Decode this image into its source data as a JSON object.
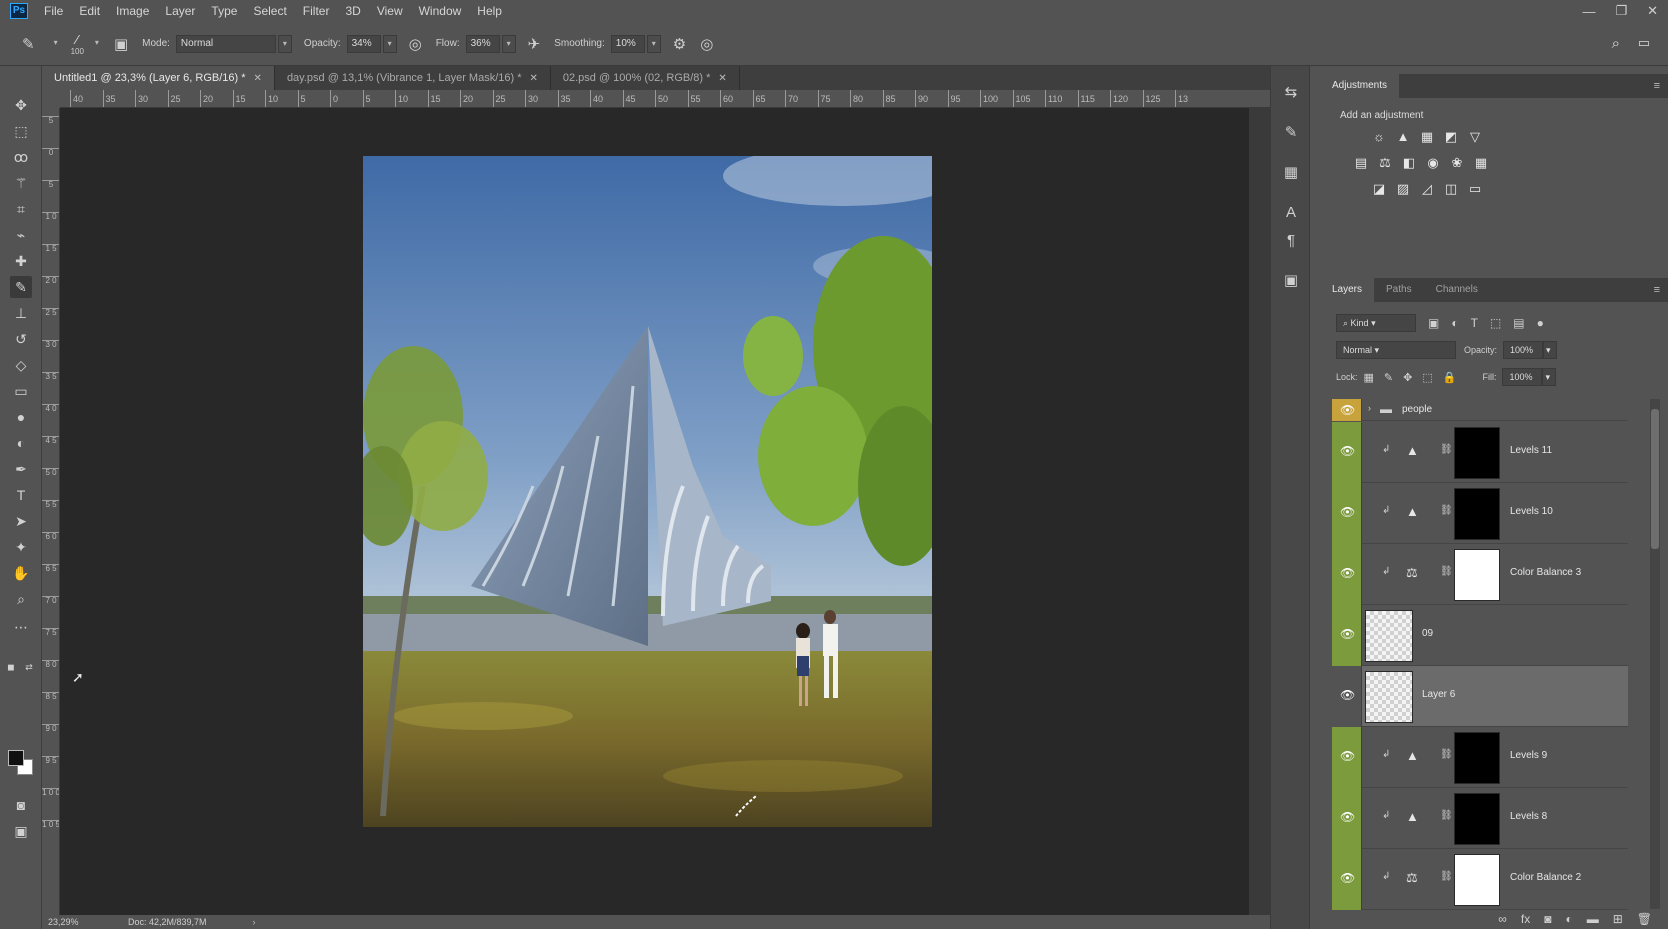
{
  "menu": [
    "File",
    "Edit",
    "Image",
    "Layer",
    "Type",
    "Select",
    "Filter",
    "3D",
    "View",
    "Window",
    "Help"
  ],
  "app_logo": "Ps",
  "window_controls": [
    "—",
    "❐",
    "✕"
  ],
  "options": {
    "brush_size": "100",
    "mode_label": "Mode:",
    "mode_value": "Normal",
    "opacity_label": "Opacity:",
    "opacity_value": "34%",
    "flow_label": "Flow:",
    "flow_value": "36%",
    "smoothing_label": "Smoothing:",
    "smoothing_value": "10%"
  },
  "doc_tabs": [
    {
      "title": "Untitled1 @ 23,3% (Layer 6, RGB/16) *",
      "active": true
    },
    {
      "title": "day.psd @ 13,1% (Vibrance 1, Layer Mask/16) *",
      "active": false
    },
    {
      "title": "02.psd @ 100% (02, RGB/8) *",
      "active": false
    }
  ],
  "ruler_h": [
    "40",
    "35",
    "30",
    "25",
    "20",
    "15",
    "10",
    "5",
    "0",
    "5",
    "10",
    "15",
    "20",
    "25",
    "30",
    "35",
    "40",
    "45",
    "50",
    "55",
    "60",
    "65",
    "70",
    "75",
    "80",
    "85",
    "90",
    "95",
    "100",
    "105",
    "110",
    "115",
    "120",
    "125",
    "13"
  ],
  "ruler_v": [
    "5",
    "0",
    "5",
    "1 0",
    "1 5",
    "2 0",
    "2 5",
    "3 0",
    "3 5",
    "4 0",
    "4 5",
    "5 0",
    "5 5",
    "6 0",
    "6 5",
    "7 0",
    "7 5",
    "8 0",
    "8 5",
    "9 0",
    "9 5",
    "1 0 0",
    "1 0 5"
  ],
  "status": {
    "zoom": "23,29%",
    "doc": "Doc: 42,2M/839,7M"
  },
  "adjustments": {
    "tab": "Adjustments",
    "subtitle": "Add an adjustment",
    "rows": [
      [
        "brightness-icon",
        "levels-icon",
        "curves-icon",
        "exposure-icon",
        "vibrance-icon"
      ],
      [
        "hue-saturation-icon",
        "color-balance-icon",
        "black-white-icon",
        "photo-filter-icon",
        "channel-mixer-icon",
        "color-lookup-icon"
      ],
      [
        "invert-icon",
        "posterize-icon",
        "threshold-icon",
        "selective-color-icon",
        "gradient-map-icon"
      ]
    ],
    "glyphs": [
      [
        "☼",
        "▲",
        "▦",
        "◩",
        "▽"
      ],
      [
        "▤",
        "⚖",
        "◧",
        "◉",
        "❀",
        "▦"
      ],
      [
        "◪",
        "▨",
        "◿",
        "◫",
        "▭"
      ]
    ]
  },
  "layers_panel": {
    "tabs": [
      "Layers",
      "Paths",
      "Channels"
    ],
    "filter_kind": "Kind",
    "blend_mode": "Normal",
    "opacity_label": "Opacity:",
    "opacity_value": "100%",
    "lock_label": "Lock:",
    "fill_label": "Fill:",
    "fill_value": "100%",
    "group_name": "people",
    "layers": [
      {
        "name": "Levels 11",
        "kind": "levels",
        "mask": "black",
        "visible": true,
        "selected": false
      },
      {
        "name": "Levels 10",
        "kind": "levels",
        "mask": "black",
        "visible": true,
        "selected": false
      },
      {
        "name": "Color Balance 3",
        "kind": "color-balance",
        "mask": "white",
        "visible": true,
        "selected": false
      },
      {
        "name": "09",
        "kind": "pixel",
        "mask": "",
        "visible": true,
        "selected": false
      },
      {
        "name": "Layer 6",
        "kind": "pixel",
        "mask": "",
        "visible": true,
        "selected": true
      },
      {
        "name": "Levels 9",
        "kind": "levels",
        "mask": "black",
        "visible": true,
        "selected": false
      },
      {
        "name": "Levels 8",
        "kind": "levels",
        "mask": "black",
        "visible": true,
        "selected": false
      },
      {
        "name": "Color Balance 2",
        "kind": "color-balance",
        "mask": "white",
        "visible": true,
        "selected": false
      }
    ]
  },
  "colors": {
    "visible_eye_bg": "#7c9b3c",
    "group_eye_bg": "#c8a23a",
    "selected_layer_bg": "#6b6b6b",
    "foreground": "#111111",
    "background": "#ffffff"
  }
}
